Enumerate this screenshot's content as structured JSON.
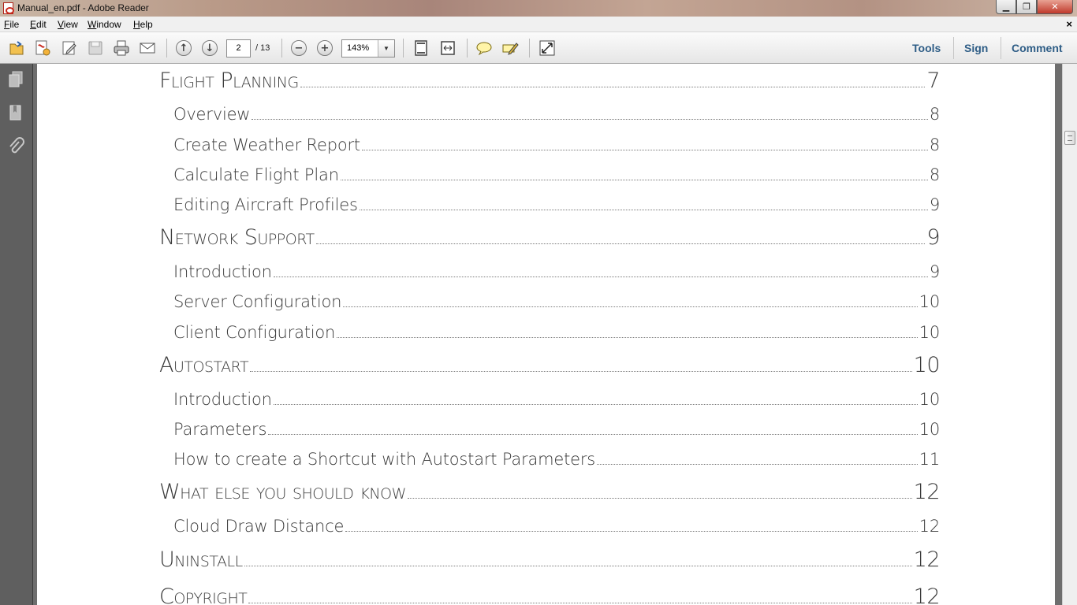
{
  "window": {
    "title": "Manual_en.pdf - Adobe Reader"
  },
  "menubar": {
    "items": [
      {
        "label": "File",
        "ul": "F",
        "rest": "ile"
      },
      {
        "label": "Edit",
        "ul": "E",
        "rest": "dit"
      },
      {
        "label": "View",
        "ul": "V",
        "rest": "iew"
      },
      {
        "label": "Window",
        "ul": "W",
        "rest": "indow"
      },
      {
        "label": "Help",
        "ul": "H",
        "rest": "elp"
      }
    ],
    "close_glyph": "×"
  },
  "toolbar": {
    "current_page": "2",
    "page_count": "/ 13",
    "zoom": "143%",
    "right_tabs": [
      "Tools",
      "Sign",
      "Comment"
    ]
  },
  "icons": {
    "toolbar": [
      "open-icon",
      "create-pdf-icon",
      "edit-icon",
      "save-icon",
      "print-icon",
      "email-icon",
      "page-up-icon",
      "page-down-icon",
      "zoom-out-icon",
      "zoom-in-icon",
      "fit-page-icon",
      "fit-width-icon",
      "sticky-note-icon",
      "highlight-icon",
      "full-screen-icon"
    ],
    "leftnav": [
      "page-thumbnails-icon",
      "bookmarks-icon",
      "attachments-icon"
    ]
  },
  "colors": {
    "accent": "#2e5d86",
    "text": "#3a3a3a"
  },
  "toc": [
    {
      "level": 1,
      "label": "Flight Planning",
      "page": "7"
    },
    {
      "level": 2,
      "label": "Overview",
      "page": "8"
    },
    {
      "level": 2,
      "label": "Create Weather Report",
      "page": "8"
    },
    {
      "level": 2,
      "label": "Calculate Flight Plan",
      "page": "8"
    },
    {
      "level": 2,
      "label": "Editing Aircraft Profiles",
      "page": "9"
    },
    {
      "level": 1,
      "label": "Network Support",
      "page": "9"
    },
    {
      "level": 2,
      "label": "Introduction",
      "page": "9"
    },
    {
      "level": 2,
      "label": "Server Configuration",
      "page": "10"
    },
    {
      "level": 2,
      "label": "Client Configuration",
      "page": "10"
    },
    {
      "level": 1,
      "label": "Autostart",
      "page": "10"
    },
    {
      "level": 2,
      "label": "Introduction",
      "page": "10"
    },
    {
      "level": 2,
      "label": "Parameters",
      "page": "10"
    },
    {
      "level": 2,
      "label": "How to create a Shortcut with Autostart Parameters",
      "page": "11"
    },
    {
      "level": 1,
      "label": "What else you should know",
      "page": "12"
    },
    {
      "level": 2,
      "label": "Cloud Draw Distance",
      "page": "12"
    },
    {
      "level": 1,
      "label": "Uninstall",
      "page": "12"
    },
    {
      "level": 1,
      "label": "Copyright",
      "page": "12"
    }
  ]
}
